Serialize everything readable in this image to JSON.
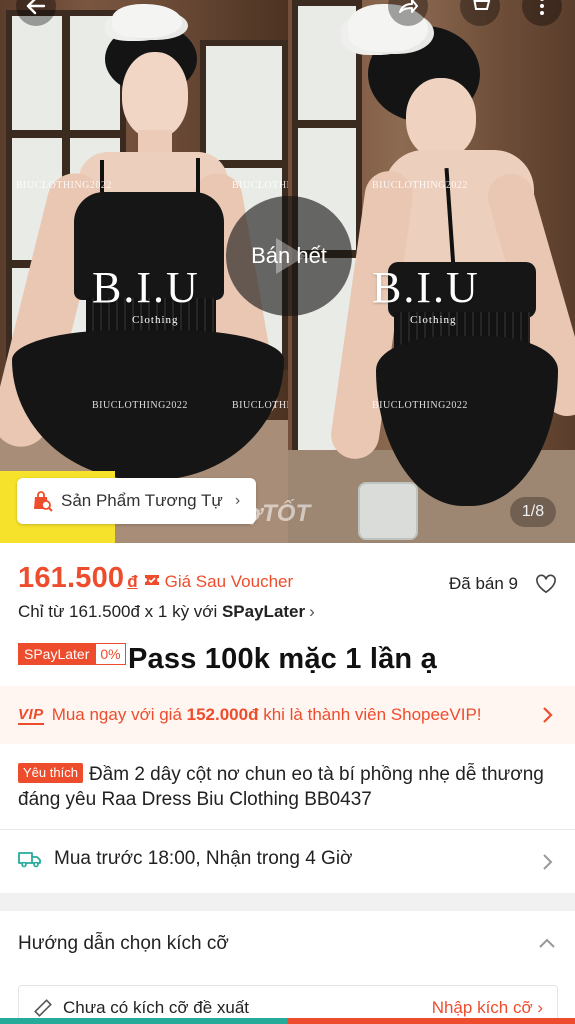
{
  "header": {
    "back_icon": "arrow-left-icon",
    "share_icon": "share-icon",
    "cart_icon": "cart-icon",
    "more_icon": "more-vertical-icon"
  },
  "gallery": {
    "brand_main": "B.I.U",
    "brand_sub": "Clothing",
    "watermark": "BIUCLOTHING2022",
    "video_status": "Bán hết",
    "similar_products_label": "Sản Phẩm Tương Tự",
    "similar_chevron": "›",
    "site_watermark": "chợTỐT",
    "counter": "1/8"
  },
  "price": {
    "value": "161.500",
    "currency": "đ",
    "voucher_label": "Giá Sau Voucher",
    "sold": "Đã bán 9"
  },
  "paylater": {
    "prefix": "Chỉ từ 161.500đ x 1 kỳ với ",
    "brand": "SPayLater",
    "chevron": "›",
    "tag": "SPayLater",
    "tag_pct": "0%"
  },
  "note": "Pass 100k mặc 1 lần ạ",
  "vip": {
    "badge": "VIP",
    "prefix": "Mua ngay với giá ",
    "price": "152.000đ",
    "suffix": " khi là thành viên ShopeeVIP!"
  },
  "product": {
    "favorite_tag": "Yêu thích",
    "title": "Đầm 2 dây cột nơ chun eo tà bí phồng nhẹ dễ thương đáng yêu Raa Dress Biu Clothing BB0437"
  },
  "delivery": {
    "text": "Mua trước 18:00, Nhận trong 4 Giờ"
  },
  "size_guide": {
    "title": "Hướng dẫn chọn kích cỡ",
    "no_suggestion": "Chưa có kích cỡ đề xuất",
    "enter_size": "Nhập kích cỡ ›"
  },
  "colors": {
    "accent": "#ee4d2d",
    "vip_bg": "#fff5f1",
    "highlight_yellow": "#f7e22b"
  }
}
